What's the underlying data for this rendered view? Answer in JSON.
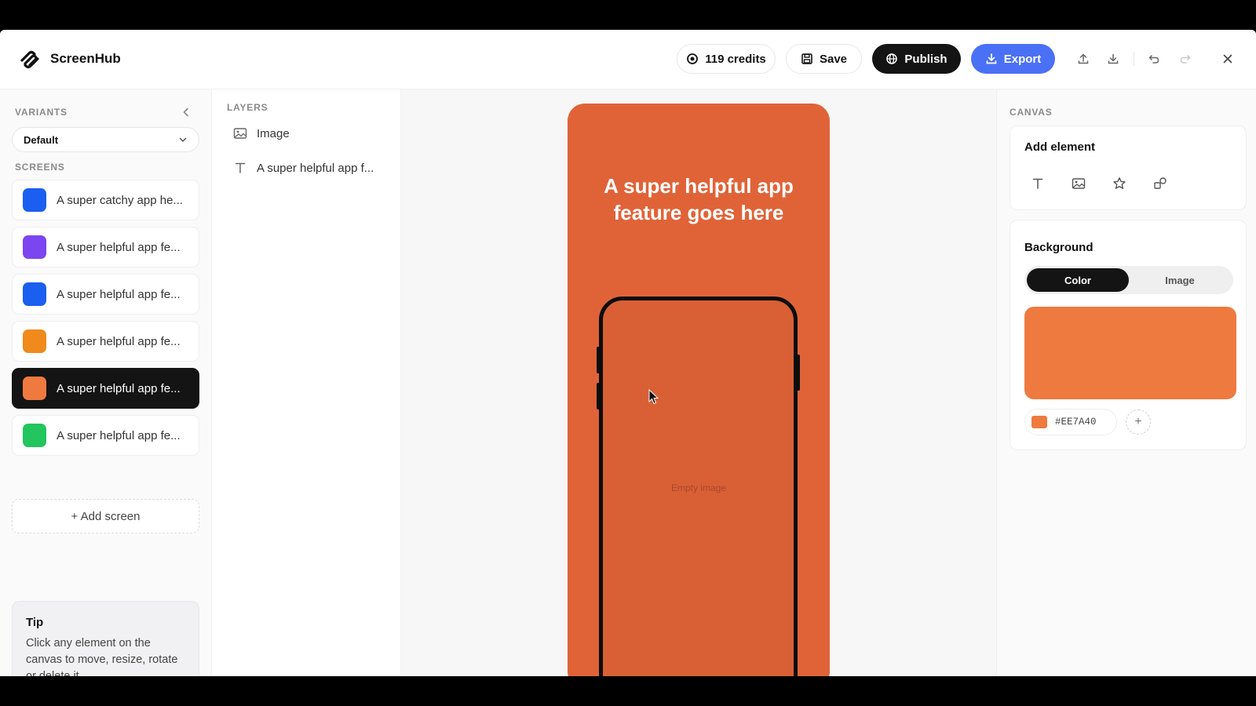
{
  "app": {
    "name": "ScreenHub"
  },
  "toolbar": {
    "credits_label": "119 credits",
    "save_label": "Save",
    "publish_label": "Publish",
    "export_label": "Export"
  },
  "sidebar": {
    "variants_label": "VARIANTS",
    "variant_selected": "Default",
    "screens_label": "SCREENS",
    "screens": [
      {
        "label": "A super catchy app he...",
        "color": "#1a5ff0"
      },
      {
        "label": "A super helpful app fe...",
        "color": "#7b46ef"
      },
      {
        "label": "A super helpful app fe...",
        "color": "#1a5ff0"
      },
      {
        "label": "A super helpful app fe...",
        "color": "#f08a1c"
      },
      {
        "label": "A super helpful app fe...",
        "color": "#ee7a40",
        "active": true
      },
      {
        "label": "A super helpful app fe...",
        "color": "#22c55e"
      }
    ],
    "add_screen_label": "+ Add screen",
    "tip": {
      "title": "Tip",
      "body": "Click any element on the canvas to move, resize, rotate or delete it."
    }
  },
  "layers": {
    "label": "LAYERS",
    "items": [
      {
        "label": "Image",
        "icon": "image-icon"
      },
      {
        "label": "A super helpful app f...",
        "icon": "text-icon"
      }
    ]
  },
  "canvas": {
    "headline": "A super helpful app feature goes here",
    "empty_image_label": "Empty image",
    "background_color": "#e06338"
  },
  "right_panel": {
    "label": "CANVAS",
    "add_element_title": "Add element",
    "add_element_icons": [
      "text-icon",
      "image-icon",
      "star-icon",
      "shapes-icon"
    ],
    "background_title": "Background",
    "bg_tabs": [
      "Color",
      "Image"
    ],
    "bg_tab_active": "Color",
    "bg_color_hex": "#EE7A40"
  },
  "colors": {
    "accent_blue": "#4a70f5",
    "dark": "#141414",
    "poster_orange": "#e06338"
  }
}
